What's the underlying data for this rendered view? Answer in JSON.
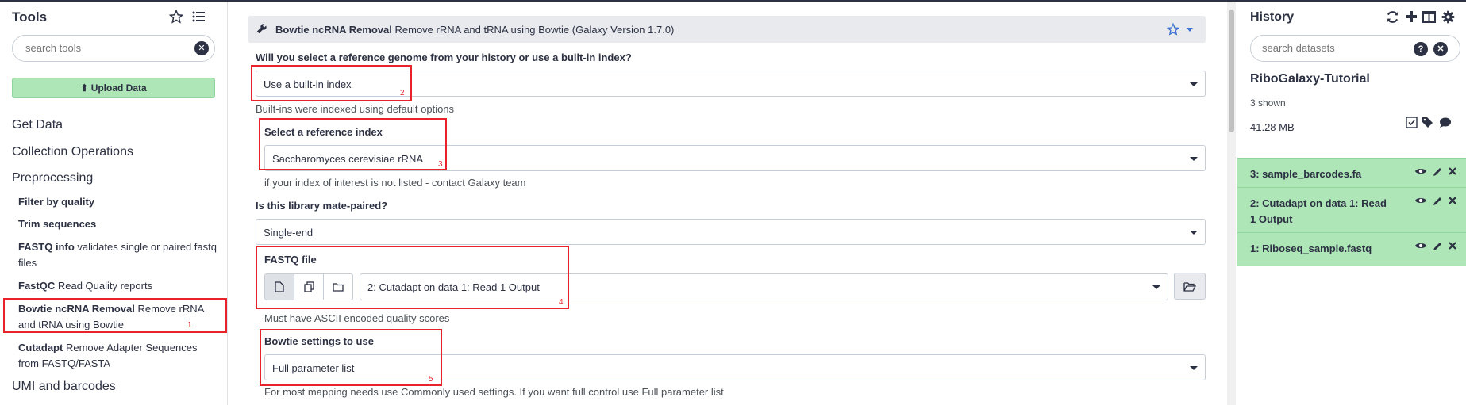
{
  "tools_panel": {
    "title": "Tools",
    "search_placeholder": "search tools",
    "upload_label": "Upload Data",
    "sections": [
      "Get Data",
      "Collection Operations",
      "Preprocessing"
    ],
    "section_bottom": "UMI and barcodes",
    "tools": [
      {
        "name": "Filter by quality",
        "desc": ""
      },
      {
        "name": "Trim sequences",
        "desc": ""
      },
      {
        "name": "FASTQ info",
        "desc": " validates single or paired fastq files"
      },
      {
        "name": "FastQC",
        "desc": " Read Quality reports"
      },
      {
        "name": "Bowtie ncRNA Removal",
        "desc": " Remove rRNA and tRNA using Bowtie"
      },
      {
        "name": "Cutadapt",
        "desc": " Remove Adapter Sequences from FASTQ/FASTA"
      }
    ]
  },
  "form": {
    "tool_name": "Bowtie ncRNA Removal",
    "tool_desc": " Remove rRNA and tRNA using Bowtie (Galaxy Version 1.7.0)",
    "q_reference": "Will you select a reference genome from your history or use a built-in index?",
    "reference_value": "Use a built-in index",
    "reference_help": "Built-ins were indexed using default options",
    "index_label": "Select a reference index",
    "index_value": "Saccharomyces cerevisiae rRNA",
    "index_help": "if your index of interest is not listed - contact Galaxy team",
    "q_mate": "Is this library mate-paired?",
    "mate_value": "Single-end",
    "fastq_label": "FASTQ file",
    "fastq_value": "2: Cutadapt on data 1: Read 1 Output",
    "fastq_help": "Must have ASCII encoded quality scores",
    "settings_label": "Bowtie settings to use",
    "settings_value": "Full parameter list",
    "settings_help": "For most mapping needs use Commonly used settings. If you want full control use Full parameter list"
  },
  "annotations": [
    "1",
    "2",
    "3",
    "4",
    "5"
  ],
  "history": {
    "title": "History",
    "search_placeholder": "search datasets",
    "name": "RiboGalaxy-Tutorial",
    "shown": "3 shown",
    "size": "41.28 MB",
    "datasets": [
      {
        "label": "3: sample_barcodes.fa"
      },
      {
        "label": "2: Cutadapt on data 1: Read 1 Output"
      },
      {
        "label": "1: Riboseq_sample.fastq"
      }
    ]
  },
  "colors": {
    "accent_green": "#aee6b7",
    "annotation_red": "#e8222a",
    "text_dark": "#2c3143"
  },
  "icons": [
    "star-icon",
    "list-icon",
    "close-icon",
    "upload-icon",
    "wrench-icon",
    "chevron-down-icon",
    "file-icon",
    "copy-icon",
    "folder-icon",
    "folder-open-icon",
    "refresh-icon",
    "plus-icon",
    "columns-icon",
    "gear-icon",
    "question-icon",
    "checkbox-icon",
    "tags-icon",
    "comment-icon",
    "eye-icon",
    "pencil-icon"
  ]
}
